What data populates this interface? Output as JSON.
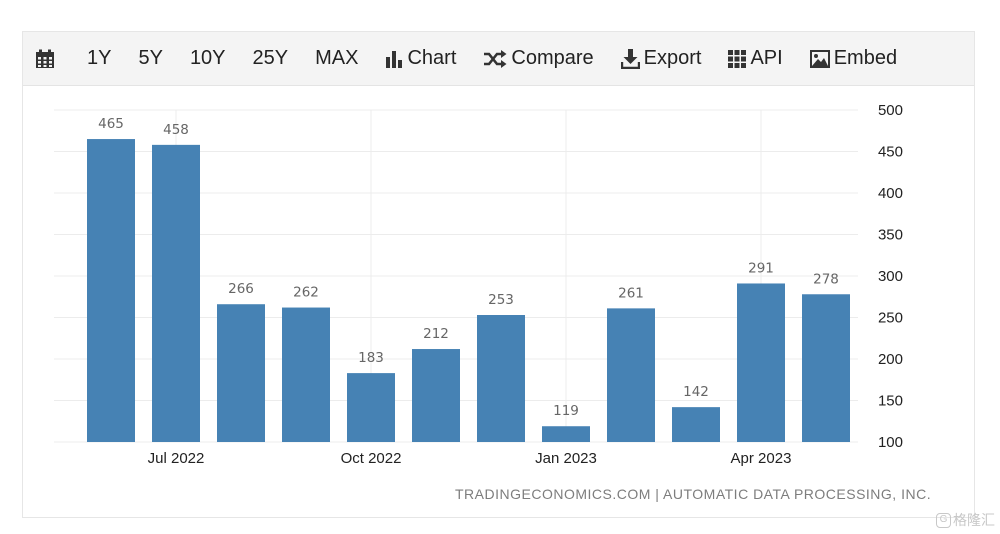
{
  "toolbar": {
    "items": [
      {
        "label": "",
        "icon": "calendar-icon"
      },
      {
        "label": "1Y"
      },
      {
        "label": "5Y"
      },
      {
        "label": "10Y"
      },
      {
        "label": "25Y"
      },
      {
        "label": "MAX"
      },
      {
        "label": "Chart",
        "icon": "bar-chart-icon"
      },
      {
        "label": "Compare",
        "icon": "shuffle-icon"
      },
      {
        "label": "Export",
        "icon": "download-icon"
      },
      {
        "label": "API",
        "icon": "grid-icon"
      },
      {
        "label": "Embed",
        "icon": "image-icon"
      }
    ]
  },
  "colors": {
    "bar": "#4682b4",
    "grid": "#ececec",
    "toolbar_bg": "#f4f4f4"
  },
  "chart_data": {
    "type": "bar",
    "categories": [
      "2022-06",
      "2022-07",
      "2022-08",
      "2022-09",
      "2022-10",
      "2022-11",
      "2022-12",
      "2023-01",
      "2023-02",
      "2023-03",
      "2023-04",
      "2023-05"
    ],
    "values": [
      465,
      458,
      266,
      262,
      183,
      212,
      253,
      119,
      261,
      142,
      291,
      278
    ],
    "data_labels": [
      "465",
      "458",
      "266",
      "262",
      "183",
      "212",
      "253",
      "119",
      "261",
      "142",
      "291",
      "278"
    ],
    "x_tick_labels": [
      {
        "label": "Jul 2022",
        "category": "2022-07"
      },
      {
        "label": "Oct 2022",
        "category": "2022-10"
      },
      {
        "label": "Jan 2023",
        "category": "2023-01"
      },
      {
        "label": "Apr 2023",
        "category": "2023-04"
      }
    ],
    "y_ticks": [
      100,
      150,
      200,
      250,
      300,
      350,
      400,
      450,
      500
    ],
    "ylim": [
      100,
      500
    ],
    "y_axis_side": "right",
    "grid": true,
    "title": "",
    "xlabel": "",
    "ylabel": ""
  },
  "source_text": "TRADINGECONOMICS.COM | AUTOMATIC DATA PROCESSING, INC.",
  "watermark": {
    "logo": "G",
    "text": "格隆汇"
  }
}
